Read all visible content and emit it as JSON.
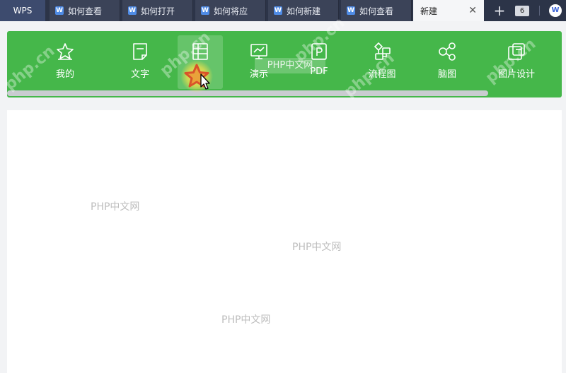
{
  "app_tab": "WPS",
  "tabs": [
    {
      "label": "如何查看"
    },
    {
      "label": "如何打开"
    },
    {
      "label": "如何将应"
    },
    {
      "label": "如何新建"
    },
    {
      "label": "如何查看"
    }
  ],
  "active_tab": "新建",
  "tab_count": "6",
  "categories": [
    {
      "label": "我的",
      "icon": "star-outline-icon"
    },
    {
      "label": "文字",
      "icon": "document-icon"
    },
    {
      "label": "",
      "icon": "table-icon"
    },
    {
      "label": "演示",
      "icon": "presentation-icon"
    },
    {
      "label": "PDF",
      "icon": "pdf-icon"
    },
    {
      "label": "流程图",
      "icon": "flowchart-icon"
    },
    {
      "label": "脑图",
      "icon": "mindmap-icon"
    },
    {
      "label": "图片设计",
      "icon": "image-design-icon"
    }
  ],
  "tooltip": "PHP中文网",
  "watermarks": {
    "w1": "PHP中文网",
    "w2": "PHP中文网",
    "w3": "PHP中文网",
    "diag": "php.cn"
  },
  "colors": {
    "ribbon": "#45b74a",
    "tabbar": "#2c3448",
    "star_fill": "#e06a2c"
  }
}
